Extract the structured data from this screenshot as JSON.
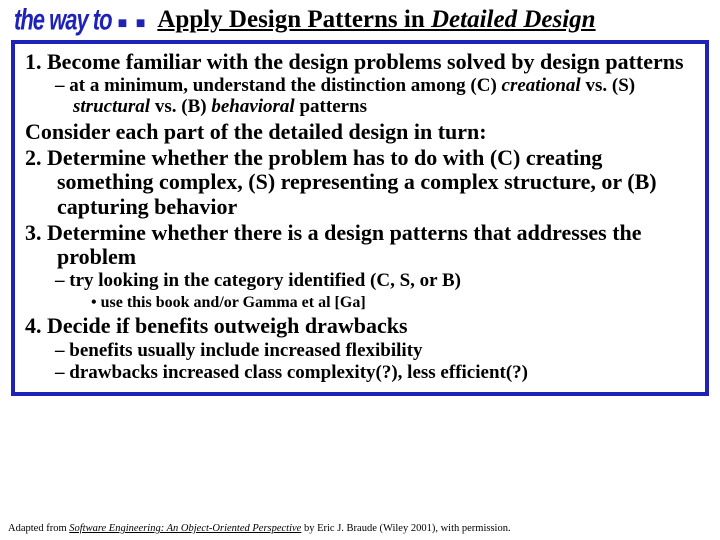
{
  "header": {
    "motto": "the way to",
    "motto_trail": "■ ■",
    "title_plain1": "Apply Design Patterns in ",
    "title_ital": "Detailed Design"
  },
  "body": {
    "p1": "1. Become familiar with the design problems solved by design patterns",
    "p1_sub_pre": "– at a minimum, understand the distinction among (C) ",
    "p1_sub_i1": "creational",
    "p1_sub_mid1": " vs. (S) ",
    "p1_sub_i2": "structural",
    "p1_sub_mid2": " vs. (B) ",
    "p1_sub_i3": "behavioral",
    "p1_sub_post": " patterns",
    "consider": "Consider each part of the detailed design in turn:",
    "p2": "2.  Determine whether the problem has to do with (C) creating something complex, (S) representing a complex structure, or (B) capturing behavior",
    "p3": "3.  Determine whether there is a design patterns that addresses the problem",
    "p3_sub": "– try looking in the category identified (C, S, or B)",
    "p3_sub2": "• use this book and/or Gamma et al [Ga]",
    "p4": "4.  Decide if benefits outweigh drawbacks",
    "p4_sub1": "– benefits usually include increased flexibility",
    "p4_sub2": "– drawbacks increased class complexity(?), less efficient(?)"
  },
  "footer": {
    "pre": "Adapted from ",
    "book": "Software Engineering: An Object-Oriented Perspective",
    "post": " by Eric J. Braude (Wiley 2001), with permission."
  }
}
